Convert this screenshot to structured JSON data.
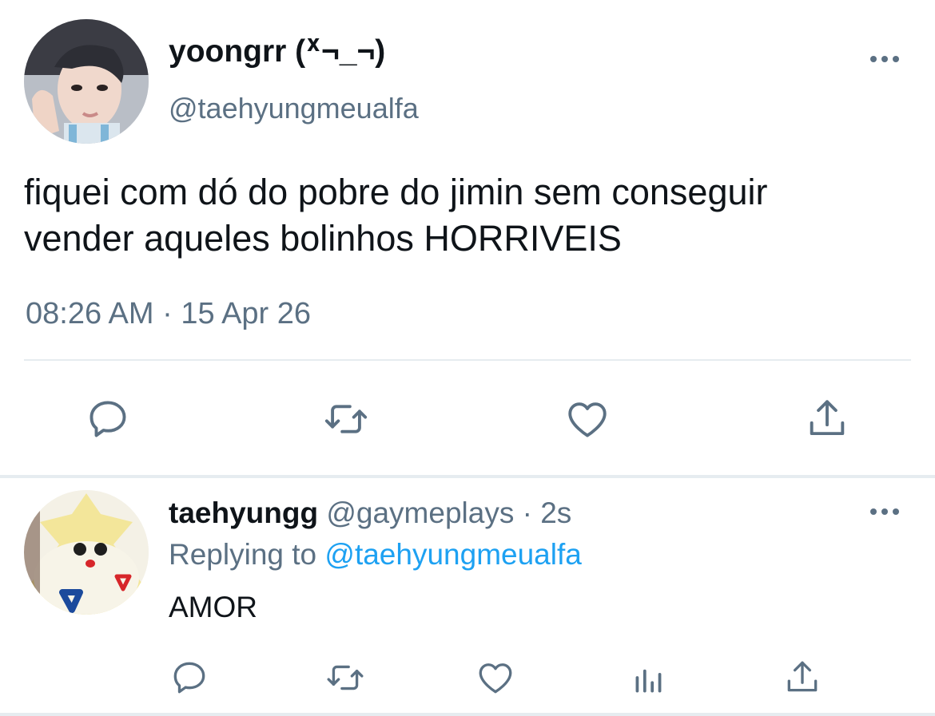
{
  "tweet": {
    "author_name": "yoongrr (ᕁ¬_¬)",
    "author_handle": "@taehyungmeualfa",
    "text_line1": "fiquei com dó do pobre do jimin sem conseguir",
    "text_line2": "vender aqueles bolinhos HORRIVEIS",
    "time": "08:26 AM",
    "separator": "·",
    "date": "15 Apr 26",
    "actions": [
      "reply-icon",
      "retweet-icon",
      "like-icon",
      "share-icon"
    ]
  },
  "reply": {
    "author_name": "taehyungg",
    "author_handle": "@gaymeplays",
    "separator": "·",
    "time": "2s",
    "replying_prefix": "Replying to",
    "replying_handle": "@taehyungmeualfa",
    "text": "AMOR",
    "actions": [
      "reply-icon",
      "retweet-icon",
      "like-icon",
      "analytics-icon",
      "share-icon"
    ]
  },
  "colors": {
    "text_primary": "#0f1419",
    "text_secondary": "#5b7083",
    "link": "#1da1f2",
    "divider": "#e6ecf0",
    "background": "#ffffff"
  }
}
